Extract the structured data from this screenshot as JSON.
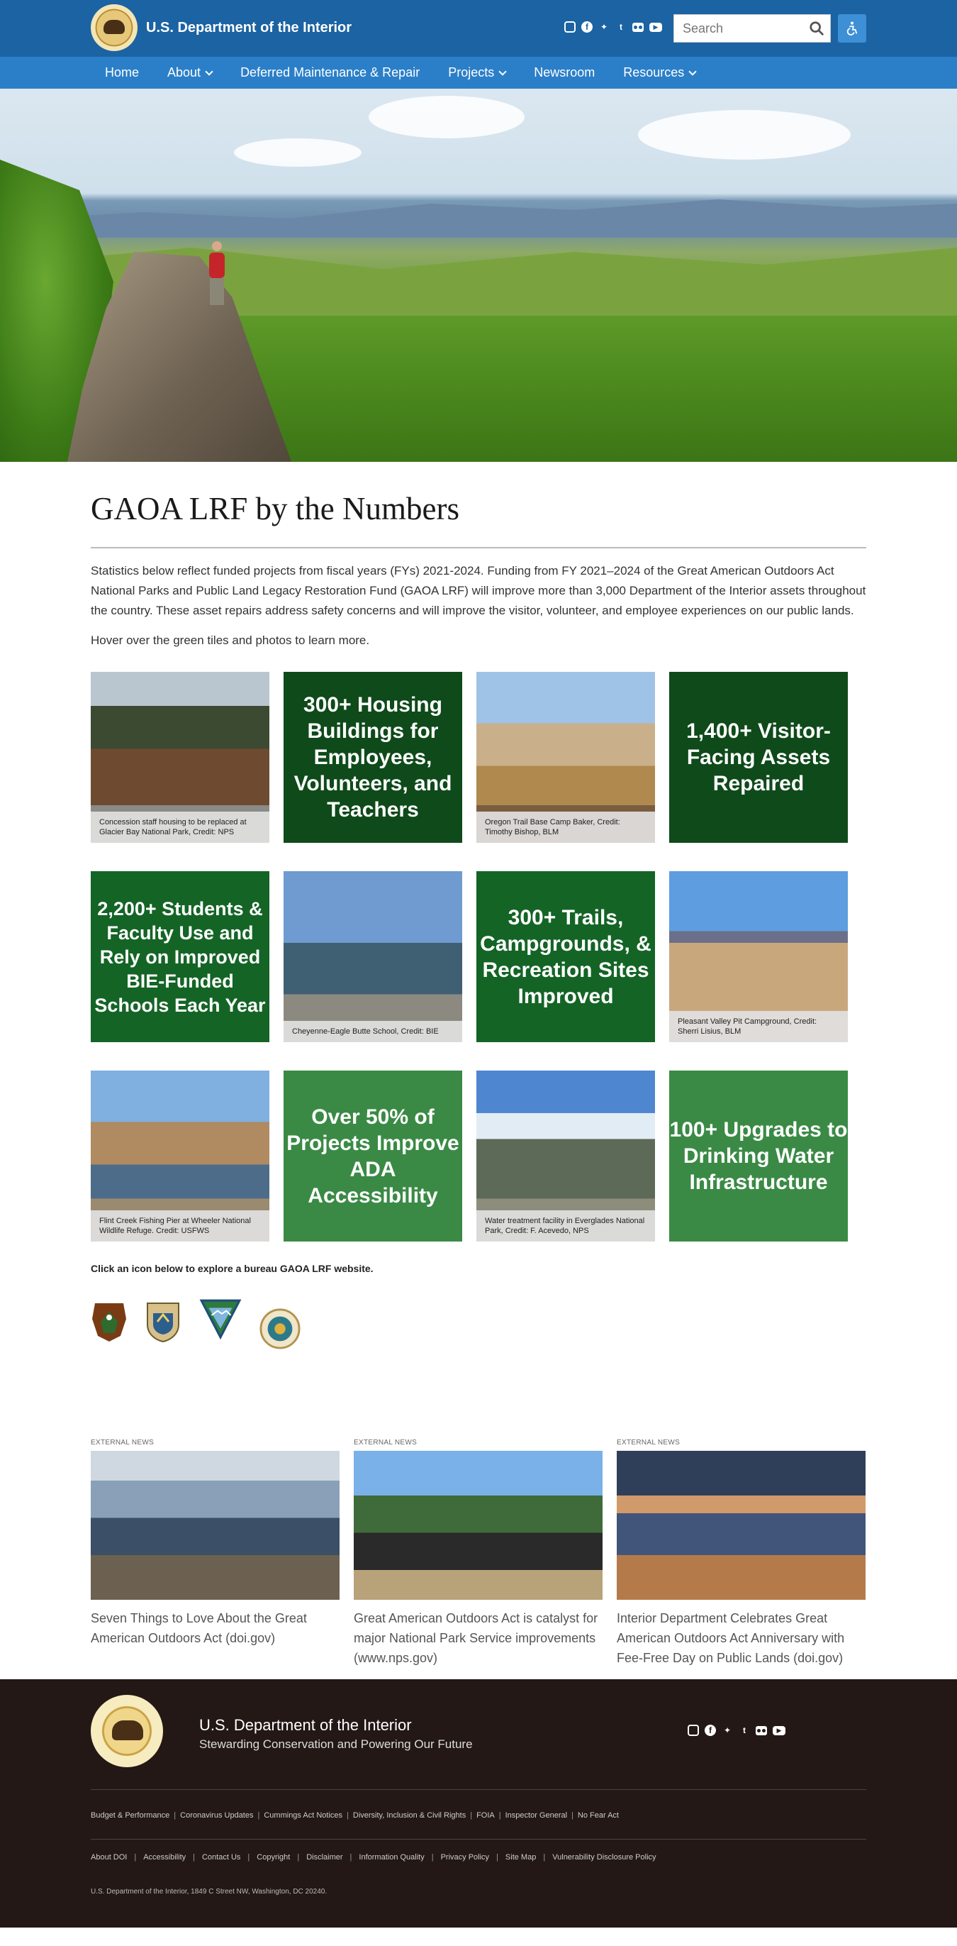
{
  "header": {
    "site_name": "U.S. Department of the Interior",
    "search_placeholder": "Search",
    "social": [
      "instagram-icon",
      "facebook-icon",
      "twitter-icon",
      "tumblr-icon",
      "flickr-icon",
      "youtube-icon"
    ]
  },
  "nav": {
    "items": [
      {
        "label": "Home",
        "has_menu": false
      },
      {
        "label": "About",
        "has_menu": true
      },
      {
        "label": "Deferred Maintenance & Repair",
        "has_menu": false
      },
      {
        "label": "Projects",
        "has_menu": true
      },
      {
        "label": "Newsroom",
        "has_menu": false
      },
      {
        "label": "Resources",
        "has_menu": true
      }
    ]
  },
  "main": {
    "title": "GAOA LRF by the Numbers",
    "intro": "Statistics below reflect funded projects from fiscal years (FYs) 2021-2024. Funding from FY 2021–2024 of the Great American Outdoors Act National Parks and Public Land Legacy Restoration Fund (GAOA LRF) will improve more than 3,000 Department of the Interior assets throughout the country.  These asset repairs address safety concerns and will improve the visitor, volunteer, and employee experiences on our public lands.",
    "hover_note": "Hover over the green tiles and photos to learn more.",
    "tiles": {
      "t1_caption": "Concession staff housing to be replaced at Glacier Bay National Park, Credit: NPS",
      "t2_stat": "300+ Housing Buildings for Employees, Volunteers, and Teachers",
      "t3_caption": "Oregon Trail Base Camp Baker, Credit: Timothy Bishop, BLM",
      "t4_stat": "1,400+ Visitor-Facing Assets Repaired",
      "t5_stat": "2,200+ Students & Faculty Use and Rely on Improved BIE-Funded Schools Each Year",
      "t6_caption": "Cheyenne-Eagle Butte School, Credit: BIE",
      "t7_stat": "300+ Trails, Campgrounds, & Recreation Sites Improved",
      "t8_caption": "Pleasant Valley Pit Campground, Credit: Sherri Lisius, BLM",
      "t9_caption": "Flint Creek Fishing Pier at Wheeler National Wildlife Refuge. Credit: USFWS",
      "t10_stat": "Over 50% of Projects Improve ADA Accessibility",
      "t11_caption": "Water treatment facility in Everglades National Park, Credit: F. Acevedo, NPS",
      "t12_stat": "100+ Upgrades to Drinking Water Infrastructure"
    },
    "bureau_label": "Click an icon below to explore a bureau GAOA LRF website.",
    "bureaus": [
      "nps-arrowhead-icon",
      "usfws-shield-icon",
      "blm-triangle-icon",
      "bie-seal-icon"
    ]
  },
  "news": [
    {
      "tag": "EXTERNAL NEWS",
      "title": "Seven Things to Love About the Great American Outdoors Act (doi.gov)"
    },
    {
      "tag": "EXTERNAL NEWS",
      "title": "Great American Outdoors Act is catalyst for major National Park Service improvements (www.nps.gov)"
    },
    {
      "tag": "EXTERNAL NEWS",
      "title": "Interior Department Celebrates Great American Outdoors Act Anniversary with Fee-Free Day on Public Lands (doi.gov)"
    }
  ],
  "footer": {
    "name": "U.S. Department of the Interior",
    "tagline": "Stewarding Conservation and Powering Our Future",
    "links_primary": [
      "Budget & Performance",
      "Coronavirus Updates",
      "Cummings Act Notices",
      "Diversity, Inclusion & Civil Rights",
      "FOIA",
      "Inspector General",
      "No Fear Act"
    ],
    "links_secondary": [
      "About DOI",
      "Accessibility",
      "Contact Us",
      "Copyright",
      "Disclaimer",
      "Information Quality",
      "Privacy Policy",
      "Site Map",
      "Vulnerability Disclosure Policy"
    ],
    "address": "U.S. Department of the Interior, 1849 C Street NW, Washington, DC 20240."
  },
  "colors": {
    "header_blue": "#1b63a2",
    "nav_blue": "#2b7fc8",
    "tile_dark_green": "#0f4a1a",
    "tile_mid_green": "#146426",
    "tile_light_green": "#3a8a45",
    "footer_bg": "#231815"
  }
}
